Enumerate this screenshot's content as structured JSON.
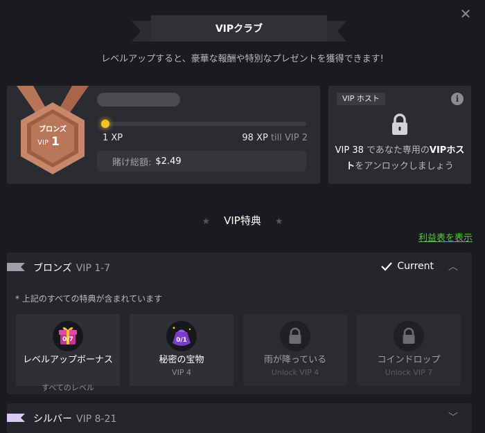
{
  "header": {
    "title": "VIPクラブ",
    "subtitle": "レベルアップすると、豪華な報酬や特別なプレゼントを獲得できます!",
    "close_symbol": "✕"
  },
  "level_card": {
    "medal": {
      "tier": "ブロンズ",
      "vip_prefix": "VIP",
      "vip_level": "1"
    },
    "xp_current": "1 XP",
    "xp_target": "98 XP",
    "xp_target_suffix": "till VIP 2",
    "progress_fraction": 0.01,
    "wager_label": "賭け総額:",
    "wager_value": "$2.49"
  },
  "host_card": {
    "badge": "VIP ホスト",
    "info_symbol": "i",
    "text_part1": "VIP 38",
    "text_part2": " であなた専用の",
    "text_part3": "VIPホス",
    "text_part4": "ト",
    "text_part5": "をアンロックしましょう"
  },
  "perks_section": {
    "heading": "VIP特典",
    "star_symbol": "★",
    "benefit_link": "利益表を表示"
  },
  "tiers": [
    {
      "name": "ブロンズ",
      "range": "VIP 1-7",
      "status": "Current",
      "chevron": "︿",
      "flag_color": "#9ea1a8",
      "note": "* 上記のすべての特典が含まれています",
      "perks": [
        {
          "title": "レベルアップボーナス",
          "sub": "すべてのレベル",
          "badge": "0/7",
          "icon": "gift-box-icon",
          "color": "#c7348f"
        },
        {
          "title": "秘密の宝物",
          "sub": "VIP 4",
          "badge": "0/1",
          "icon": "treasure-bag-icon",
          "color": "#7a3cc9"
        },
        {
          "title": "雨が降っている",
          "sub": "Unlock VIP 4",
          "icon": "lock-icon"
        },
        {
          "title": "コインドロップ",
          "sub": "Unlock VIP 7",
          "icon": "lock-icon"
        }
      ]
    },
    {
      "name": "シルバー",
      "range": "VIP 8-21",
      "chevron": "﹀",
      "flag_color": "#d8ccf5"
    }
  ],
  "colors": {
    "background": "#1a1b1f",
    "card": "#2a2c31",
    "accent_xp": "#f3c327",
    "link": "#58c43a",
    "bronze": "#c8876b"
  }
}
